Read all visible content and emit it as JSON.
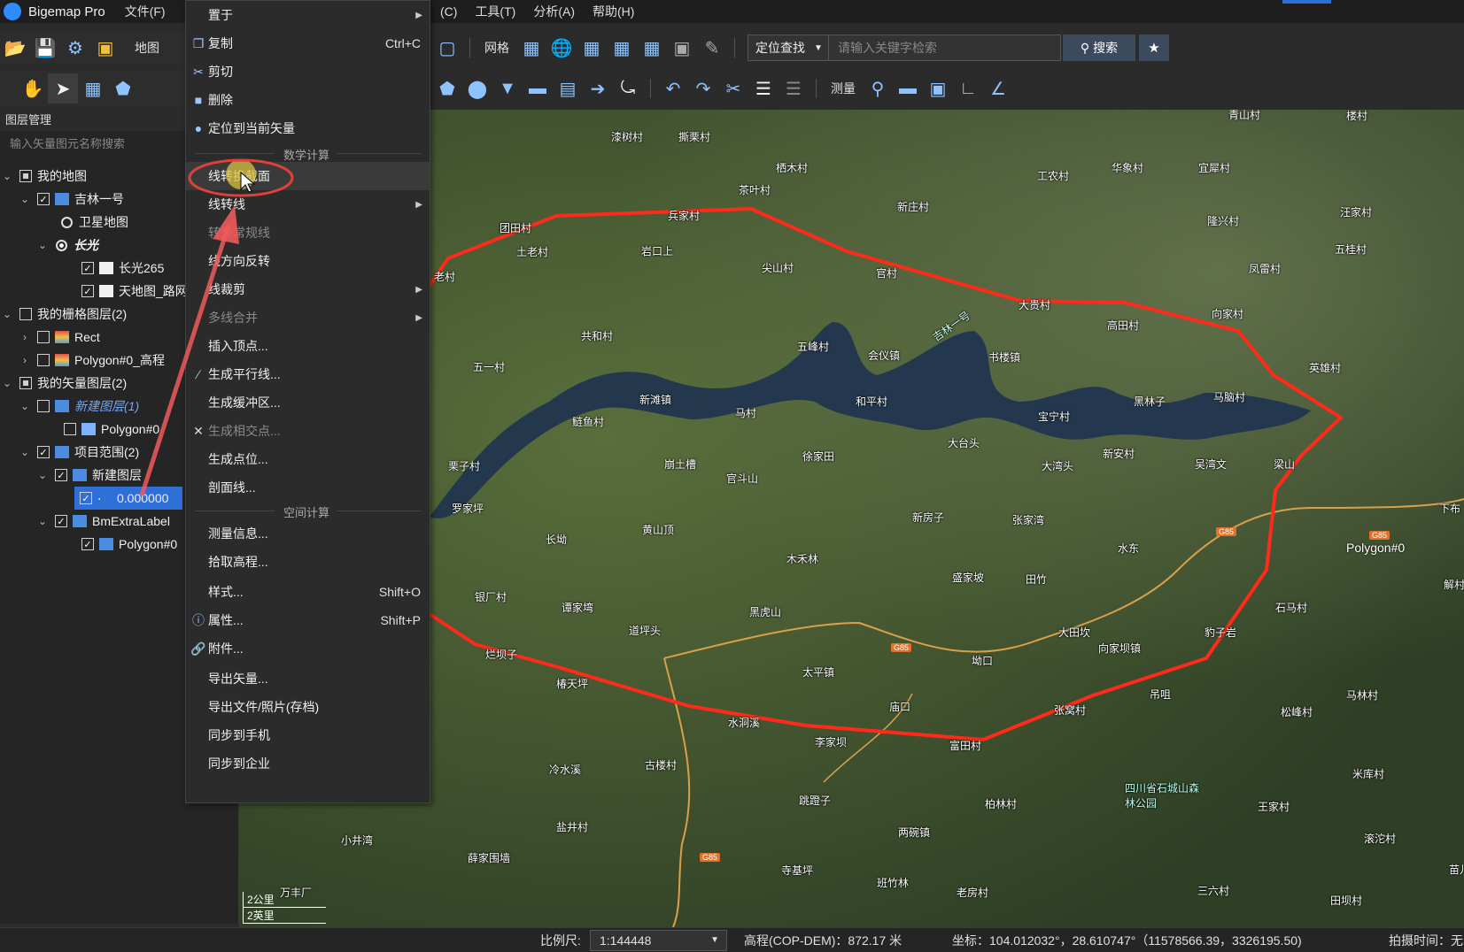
{
  "titlebar": {
    "app_title": "Bigemap Pro",
    "menu_file": "文件(F)",
    "menus_right": [
      "(C)",
      "工具(T)",
      "分析(A)",
      "帮助(H)"
    ]
  },
  "left_toolbar": {
    "map_label": "地图"
  },
  "layer_panel": {
    "title": "图层管理",
    "search_placeholder": "输入矢量图元名称搜索",
    "rows": [
      {
        "label": "我的地图"
      },
      {
        "label": "吉林一号"
      },
      {
        "label": "卫星地图"
      },
      {
        "label": "长光"
      },
      {
        "label": "长光265"
      },
      {
        "label": "天地图_路网"
      },
      {
        "label": "我的栅格图层(2)"
      },
      {
        "label": "Rect"
      },
      {
        "label": "Polygon#0_高程"
      },
      {
        "label": "我的矢量图层(2)"
      },
      {
        "label": "新建图层(1)"
      },
      {
        "label": "Polygon#0"
      },
      {
        "label": "项目范围(2)"
      },
      {
        "label": "新建图层"
      },
      {
        "label": "0.000000"
      },
      {
        "label": "BmExtraLabel"
      },
      {
        "label": "Polygon#0"
      }
    ]
  },
  "map_toolbar1": {
    "grid_label": "网格",
    "locate_select": "定位查找",
    "search_placeholder": "请输入关键字检索",
    "search_button": "搜索"
  },
  "map_toolbar2": {
    "measure_label": "测量"
  },
  "context_menu": {
    "items": [
      {
        "label": "置于",
        "shortcut": ""
      },
      {
        "label": "复制",
        "shortcut": "Ctrl+C"
      },
      {
        "label": "剪切",
        "shortcut": ""
      },
      {
        "label": "删除",
        "shortcut": ""
      },
      {
        "label": "定位到当前矢量",
        "shortcut": ""
      },
      {
        "label": "线转换截面",
        "shortcut": ""
      },
      {
        "label": "线转线",
        "shortcut": ""
      },
      {
        "label": "转为常规线",
        "shortcut": ""
      },
      {
        "label": "线方向反转",
        "shortcut": ""
      },
      {
        "label": "线裁剪",
        "shortcut": ""
      },
      {
        "label": "多线合并",
        "shortcut": ""
      },
      {
        "label": "插入顶点...",
        "shortcut": ""
      },
      {
        "label": "生成平行线...",
        "shortcut": ""
      },
      {
        "label": "生成缓冲区...",
        "shortcut": ""
      },
      {
        "label": "生成相交点...",
        "shortcut": ""
      },
      {
        "label": "生成点位...",
        "shortcut": ""
      },
      {
        "label": "剖面线...",
        "shortcut": ""
      },
      {
        "label": "测量信息...",
        "shortcut": ""
      },
      {
        "label": "拾取高程...",
        "shortcut": ""
      },
      {
        "label": "样式...",
        "shortcut": "Shift+O"
      },
      {
        "label": "属性...",
        "shortcut": "Shift+P"
      },
      {
        "label": "附件...",
        "shortcut": ""
      },
      {
        "label": "导出矢量...",
        "shortcut": ""
      },
      {
        "label": "导出文件/照片(存档)",
        "shortcut": ""
      },
      {
        "label": "同步到手机",
        "shortcut": ""
      },
      {
        "label": "同步到企业",
        "shortcut": ""
      }
    ],
    "group_math": "数学计算",
    "group_space": "空间计算"
  },
  "map": {
    "places": [
      "青山村",
      "楼村",
      "漆树村",
      "撕栗村",
      "栖木村",
      "工农村",
      "华象村",
      "宜犀村",
      "茶叶村",
      "新庄村",
      "汪家村",
      "团田村",
      "兵家村",
      "隆兴村",
      "五桂村",
      "土老村",
      "岩口上",
      "尖山村",
      "官村",
      "凤雷村",
      "老村",
      "共和村",
      "五峰村",
      "会仪镇",
      "大贵村",
      "高田村",
      "向家村",
      "英雄村",
      "五一村",
      "书楼镇",
      "吉林一号",
      "新滩镇",
      "马村",
      "和平村",
      "宝宁村",
      "黑林子",
      "马脑村",
      "鲢鱼村",
      "徐家田",
      "大台头",
      "新安村",
      "吴湾文",
      "梁山",
      "栗子村",
      "崩土槽",
      "官斗山",
      "大湾头",
      "罗家坪",
      "长坳",
      "黄山顶",
      "新房子",
      "张家湾",
      "水东",
      "下布",
      "木禾林",
      "盛家坡",
      "田竹",
      "石马村",
      "银厂村",
      "谭家塆",
      "黑虎山",
      "大田坎",
      "豹子岩",
      "解村",
      "道坪头",
      "烂坝子",
      "太平镇",
      "坳口",
      "向家坝镇",
      "吊咀",
      "马林村",
      "椿天坪",
      "庙口",
      "张窝村",
      "松峰村",
      "水洞溪",
      "李家坝",
      "富田村",
      "冷水溪",
      "古楼村",
      "四川省石城山森林公园",
      "米库村",
      "跳蹬子",
      "两碗镇",
      "柏林村",
      "王家村",
      "盐井村",
      "小井湾",
      "滚沱村",
      "薛家围墙",
      "寺基坪",
      "班竹林",
      "老房村",
      "三六村",
      "田坝村",
      "苗儿",
      "万丰厂"
    ],
    "highways": [
      "G85",
      "G85",
      "G85",
      "G85"
    ],
    "polygon_label": "Polygon#0",
    "scale_km": "2公里",
    "scale_mi": "2英里"
  },
  "statusbar": {
    "scale_label": "比例尺:",
    "scale_value": "1:144448",
    "elevation": "高程(COP-DEM)：872.17 米",
    "coords": "坐标：104.012032°，28.610747°（11578566.39，3326195.50)",
    "capture_time": "拍摄时间：无"
  }
}
